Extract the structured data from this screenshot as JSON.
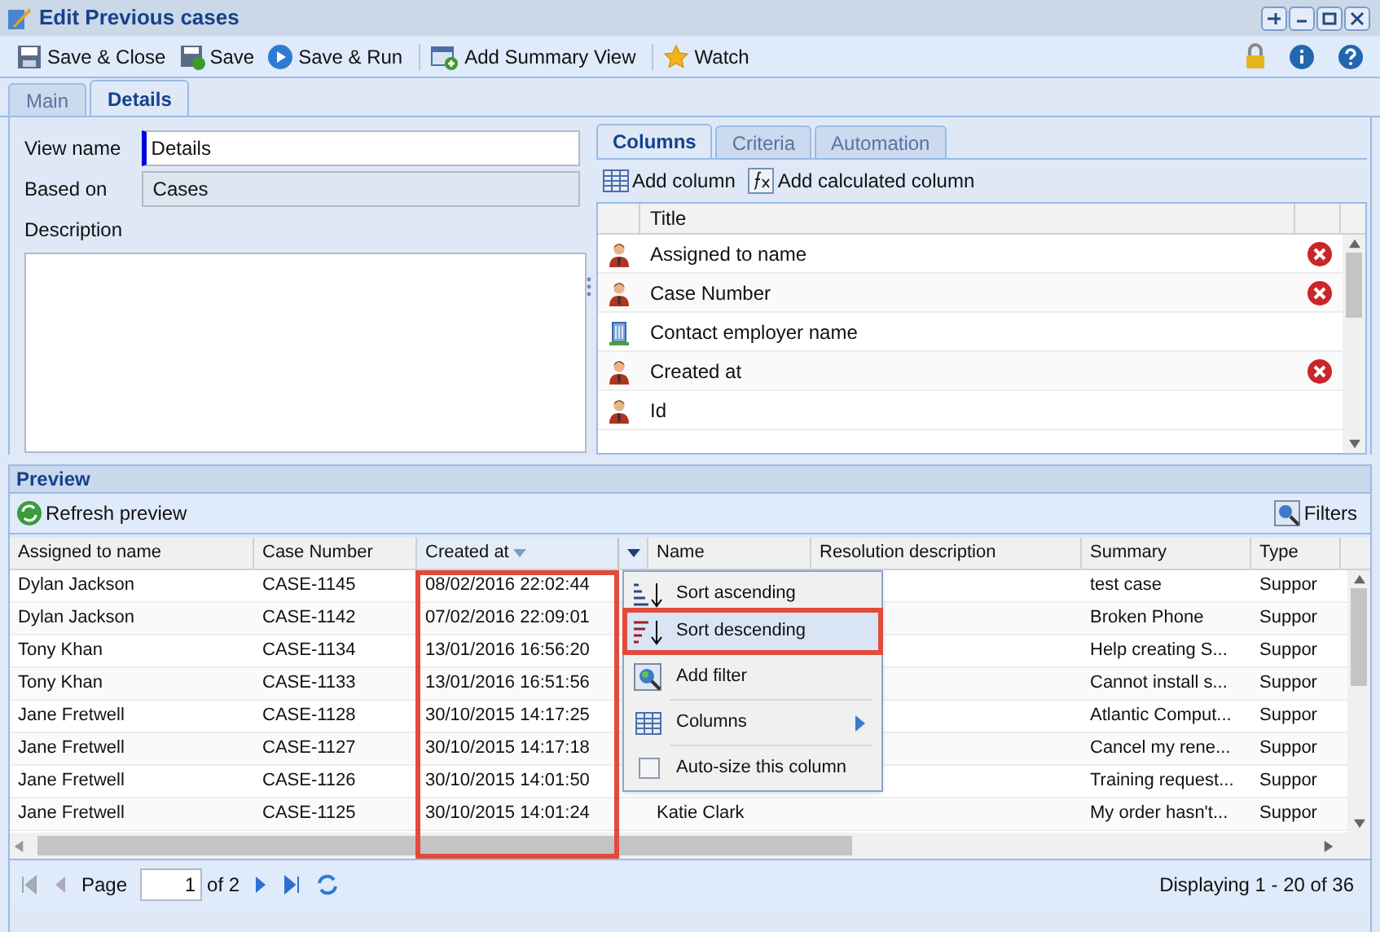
{
  "window": {
    "title": "Edit Previous cases"
  },
  "toolbar": [
    {
      "label": "Save & Close",
      "kind": "save"
    },
    {
      "label": "Save",
      "kind": "save_green"
    },
    {
      "label": "Save & Run",
      "kind": "run"
    },
    {
      "label": "Add Summary View",
      "kind": "summary"
    },
    {
      "label": "Watch",
      "kind": "star"
    }
  ],
  "tabs": [
    {
      "label": "Main",
      "selected": false
    },
    {
      "label": "Details",
      "selected": true
    }
  ],
  "form": {
    "view_name": {
      "label": "View name",
      "value": "Details"
    },
    "based_on": {
      "label": "Based on",
      "value": "Cases"
    },
    "description": {
      "label": "Description"
    }
  },
  "right_tabs": [
    {
      "label": "Columns",
      "selected": true
    },
    {
      "label": "Criteria",
      "selected": false
    },
    {
      "label": "Automation",
      "selected": false
    }
  ],
  "column_actions": [
    {
      "label": "Add column",
      "kind": "grid"
    },
    {
      "label": "Add calculated column",
      "kind": "fx"
    }
  ],
  "columns_list": {
    "header": "Title",
    "items": [
      {
        "title": "Assigned to name",
        "kind": "person",
        "removable": true
      },
      {
        "title": "Case Number",
        "kind": "person",
        "removable": true
      },
      {
        "title": "Contact employer name",
        "kind": "building",
        "removable": false
      },
      {
        "title": "Created at",
        "kind": "person",
        "removable": true
      },
      {
        "title": "Id",
        "kind": "person",
        "removable": false
      }
    ]
  },
  "preview": {
    "title": "Preview",
    "refresh": "Refresh preview",
    "filters": "Filters",
    "columns": [
      {
        "label": "Assigned to name",
        "sorted": false
      },
      {
        "label": "Case Number",
        "sorted": false
      },
      {
        "label": "Created at",
        "sorted": true
      },
      {
        "label": "Name",
        "sorted": false
      },
      {
        "label": "Resolution description",
        "sorted": false
      },
      {
        "label": "Summary",
        "sorted": false
      },
      {
        "label": "Type",
        "sorted": false
      }
    ],
    "rows": [
      [
        "Dylan Jackson",
        "CASE-1145",
        "08/02/2016 22:02:44",
        "",
        "",
        "test case",
        "Suppor"
      ],
      [
        "Dylan Jackson",
        "CASE-1142",
        "07/02/2016 22:09:01",
        "",
        "",
        "Broken Phone",
        "Suppor"
      ],
      [
        "Tony Khan",
        "CASE-1134",
        "13/01/2016 16:56:20",
        "",
        "",
        "Help creating S...",
        "Suppor"
      ],
      [
        "Tony Khan",
        "CASE-1133",
        "13/01/2016 16:51:56",
        "",
        "",
        "Cannot install s...",
        "Suppor"
      ],
      [
        "Jane Fretwell",
        "CASE-1128",
        "30/10/2015 14:17:25",
        "",
        "",
        "Atlantic Comput...",
        "Suppor"
      ],
      [
        "Jane Fretwell",
        "CASE-1127",
        "30/10/2015 14:17:18",
        "",
        "",
        "Cancel my rene...",
        "Suppor"
      ],
      [
        "Jane Fretwell",
        "CASE-1126",
        "30/10/2015 14:01:50",
        "",
        "",
        "Training request...",
        "Suppor"
      ],
      [
        "Jane Fretwell",
        "CASE-1125",
        "30/10/2015 14:01:24",
        "Katie Clark",
        "",
        "My order hasn't...",
        "Suppor"
      ]
    ],
    "menu": [
      {
        "label": "Sort ascending",
        "kind": "sort_asc",
        "selected": false
      },
      {
        "label": "Sort descending",
        "kind": "sort_desc",
        "selected": true
      },
      {
        "label": "Add filter",
        "kind": "filter",
        "selected": false
      },
      {
        "label": "Columns",
        "kind": "submenu",
        "selected": false
      },
      {
        "label": "Auto-size this column",
        "kind": "checkbox",
        "checked": false,
        "selected": false
      }
    ],
    "pager": {
      "page_label": "Page",
      "page": "1",
      "of": "of 2",
      "status": "Displaying 1 - 20 of 36"
    }
  }
}
